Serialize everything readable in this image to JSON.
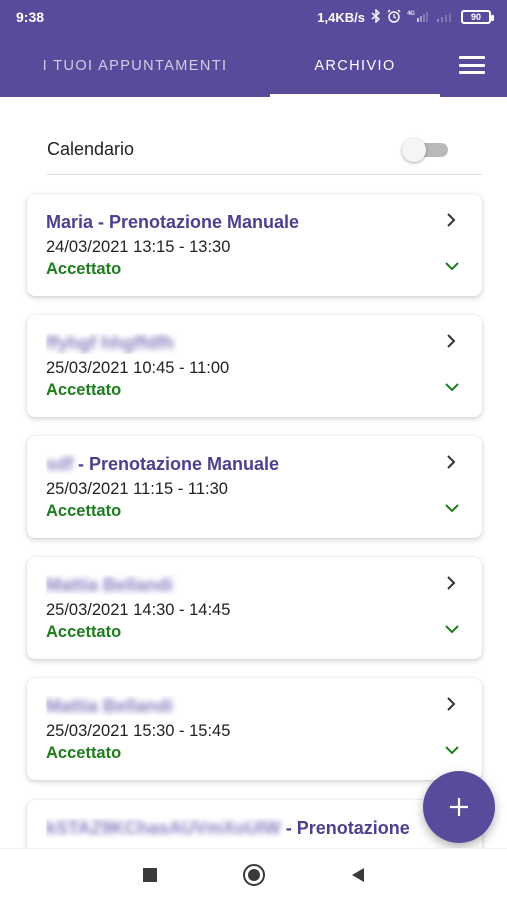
{
  "status_bar": {
    "time": "9:38",
    "network_speed": "1,4KB/s",
    "icons": [
      "bluetooth-icon",
      "alarm-icon",
      "signal-4g-icon",
      "signal-icon"
    ],
    "battery": "90"
  },
  "tabs": [
    {
      "label": "I TUOI APPUNTAMENTI",
      "active": false
    },
    {
      "label": "ARCHIVIO",
      "active": true
    }
  ],
  "calendar_toggle": {
    "label": "Calendario",
    "enabled": false
  },
  "appointments": [
    {
      "name": "Maria",
      "suffix": " - Prenotazione Manuale",
      "datetime": "24/03/2021 13:15 - 13:30",
      "status": "Accettato",
      "name_obscured": false
    },
    {
      "name": "ffyhgf hhgffdfh",
      "suffix": "",
      "datetime": "25/03/2021 10:45 - 11:00",
      "status": "Accettato",
      "name_obscured": true
    },
    {
      "name": "sdf",
      "suffix": " - Prenotazione Manuale",
      "datetime": "25/03/2021 11:15 - 11:30",
      "status": "Accettato",
      "name_obscured": true
    },
    {
      "name": "Mattia Bellandi",
      "suffix": "",
      "datetime": "25/03/2021 14:30 - 14:45",
      "status": "Accettato",
      "name_obscured": true
    },
    {
      "name": "Mattia Bellandi",
      "suffix": "",
      "datetime": "25/03/2021 15:30 - 15:45",
      "status": "Accettato",
      "name_obscured": true
    },
    {
      "name": "kSTAZ9KChasAUVmXoUIW",
      "suffix": " - Prenotazione",
      "datetime": "",
      "status": "",
      "name_obscured": true
    }
  ],
  "colors": {
    "primary": "#5a4a9c",
    "title": "#4f3f8e",
    "status_accepted": "#1e7d1e"
  },
  "fab_icon": "plus-icon",
  "nav_icons": [
    "recent-apps-icon",
    "home-icon",
    "back-icon"
  ]
}
